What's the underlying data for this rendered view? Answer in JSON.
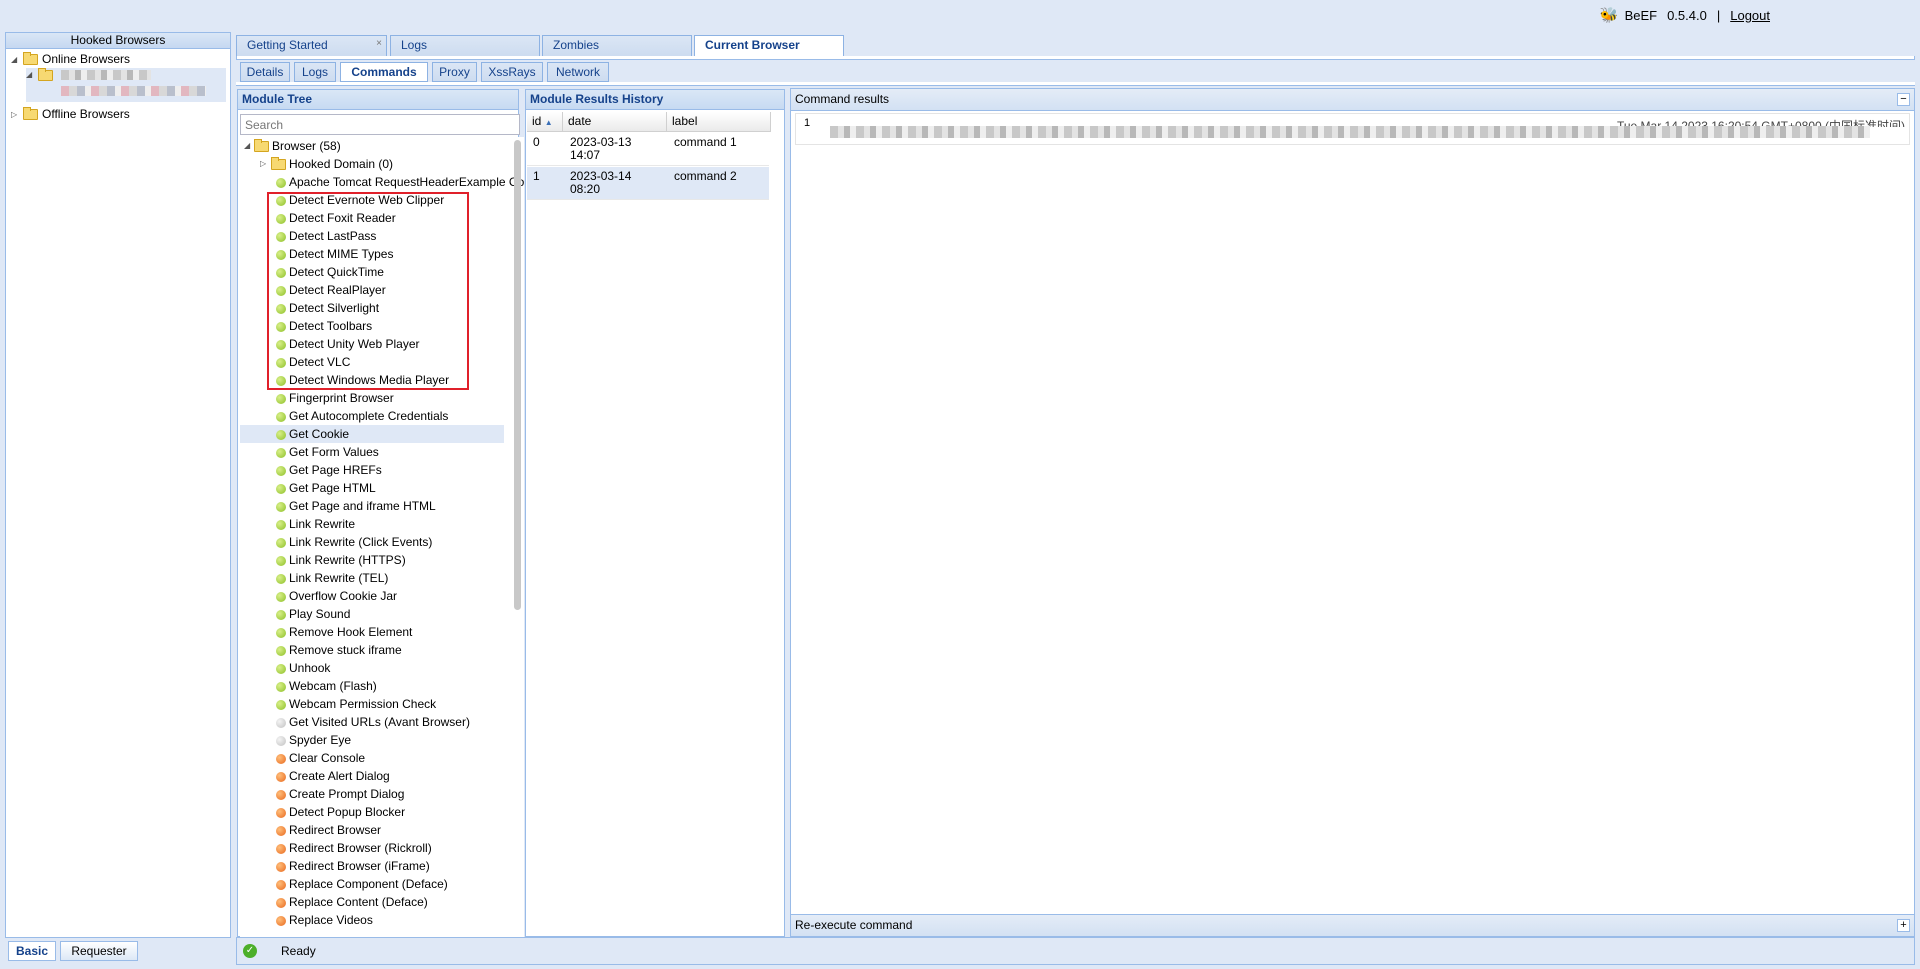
{
  "header": {
    "app_name": "BeEF",
    "version": "0.5.4.0",
    "separator": "|",
    "logout": "Logout"
  },
  "left": {
    "title": "Hooked Browsers",
    "online": "Online Browsers",
    "offline": "Offline Browsers",
    "tabs": {
      "basic": "Basic",
      "requester": "Requester"
    }
  },
  "main_tabs": [
    "Getting Started",
    "Logs",
    "Zombies",
    "Current Browser"
  ],
  "sub_tabs": [
    "Details",
    "Logs",
    "Commands",
    "Proxy",
    "XssRays",
    "Network"
  ],
  "module_tree": {
    "title": "Module Tree",
    "search_placeholder": "Search",
    "root": "Browser (58)",
    "hooked_domain": "Hooked Domain (0)",
    "modules": [
      {
        "label": "Apache Tomcat RequestHeaderExample Cookie Disclosure",
        "status": "green"
      },
      {
        "label": "Detect Evernote Web Clipper",
        "status": "green"
      },
      {
        "label": "Detect Foxit Reader",
        "status": "green"
      },
      {
        "label": "Detect LastPass",
        "status": "green"
      },
      {
        "label": "Detect MIME Types",
        "status": "green"
      },
      {
        "label": "Detect QuickTime",
        "status": "green"
      },
      {
        "label": "Detect RealPlayer",
        "status": "green"
      },
      {
        "label": "Detect Silverlight",
        "status": "green"
      },
      {
        "label": "Detect Toolbars",
        "status": "green"
      },
      {
        "label": "Detect Unity Web Player",
        "status": "green"
      },
      {
        "label": "Detect VLC",
        "status": "green"
      },
      {
        "label": "Detect Windows Media Player",
        "status": "green"
      },
      {
        "label": "Fingerprint Browser",
        "status": "green"
      },
      {
        "label": "Get Autocomplete Credentials",
        "status": "green"
      },
      {
        "label": "Get Cookie",
        "status": "green",
        "selected": true
      },
      {
        "label": "Get Form Values",
        "status": "green"
      },
      {
        "label": "Get Page HREFs",
        "status": "green"
      },
      {
        "label": "Get Page HTML",
        "status": "green"
      },
      {
        "label": "Get Page and iframe HTML",
        "status": "green"
      },
      {
        "label": "Link Rewrite",
        "status": "green"
      },
      {
        "label": "Link Rewrite (Click Events)",
        "status": "green"
      },
      {
        "label": "Link Rewrite (HTTPS)",
        "status": "green"
      },
      {
        "label": "Link Rewrite (TEL)",
        "status": "green"
      },
      {
        "label": "Overflow Cookie Jar",
        "status": "green"
      },
      {
        "label": "Play Sound",
        "status": "green"
      },
      {
        "label": "Remove Hook Element",
        "status": "green"
      },
      {
        "label": "Remove stuck iframe",
        "status": "green"
      },
      {
        "label": "Unhook",
        "status": "green"
      },
      {
        "label": "Webcam (Flash)",
        "status": "green"
      },
      {
        "label": "Webcam Permission Check",
        "status": "green"
      },
      {
        "label": "Get Visited URLs (Avant Browser)",
        "status": "grey"
      },
      {
        "label": "Spyder Eye",
        "status": "grey"
      },
      {
        "label": "Clear Console",
        "status": "orange"
      },
      {
        "label": "Create Alert Dialog",
        "status": "orange"
      },
      {
        "label": "Create Prompt Dialog",
        "status": "orange"
      },
      {
        "label": "Detect Popup Blocker",
        "status": "orange"
      },
      {
        "label": "Redirect Browser",
        "status": "orange"
      },
      {
        "label": "Redirect Browser (Rickroll)",
        "status": "orange"
      },
      {
        "label": "Redirect Browser (iFrame)",
        "status": "orange"
      },
      {
        "label": "Replace Component (Deface)",
        "status": "orange"
      },
      {
        "label": "Replace Content (Deface)",
        "status": "orange"
      },
      {
        "label": "Replace Videos",
        "status": "orange"
      }
    ]
  },
  "results_history": {
    "title": "Module Results History",
    "columns": [
      "id",
      "date",
      "label"
    ],
    "rows": [
      {
        "id": "0",
        "date": "2023-03-13 14:07",
        "label": "command 1"
      },
      {
        "id": "1",
        "date": "2023-03-14 08:20",
        "label": "command 2"
      }
    ]
  },
  "command_results": {
    "title": "Command results",
    "entry_number": "1",
    "timestamp": "Tue Mar 14 2023 16:20:54 GMT+0800 (中国标准时间)",
    "reexecute": "Re-execute command"
  },
  "status_bar": {
    "text": "Ready"
  }
}
